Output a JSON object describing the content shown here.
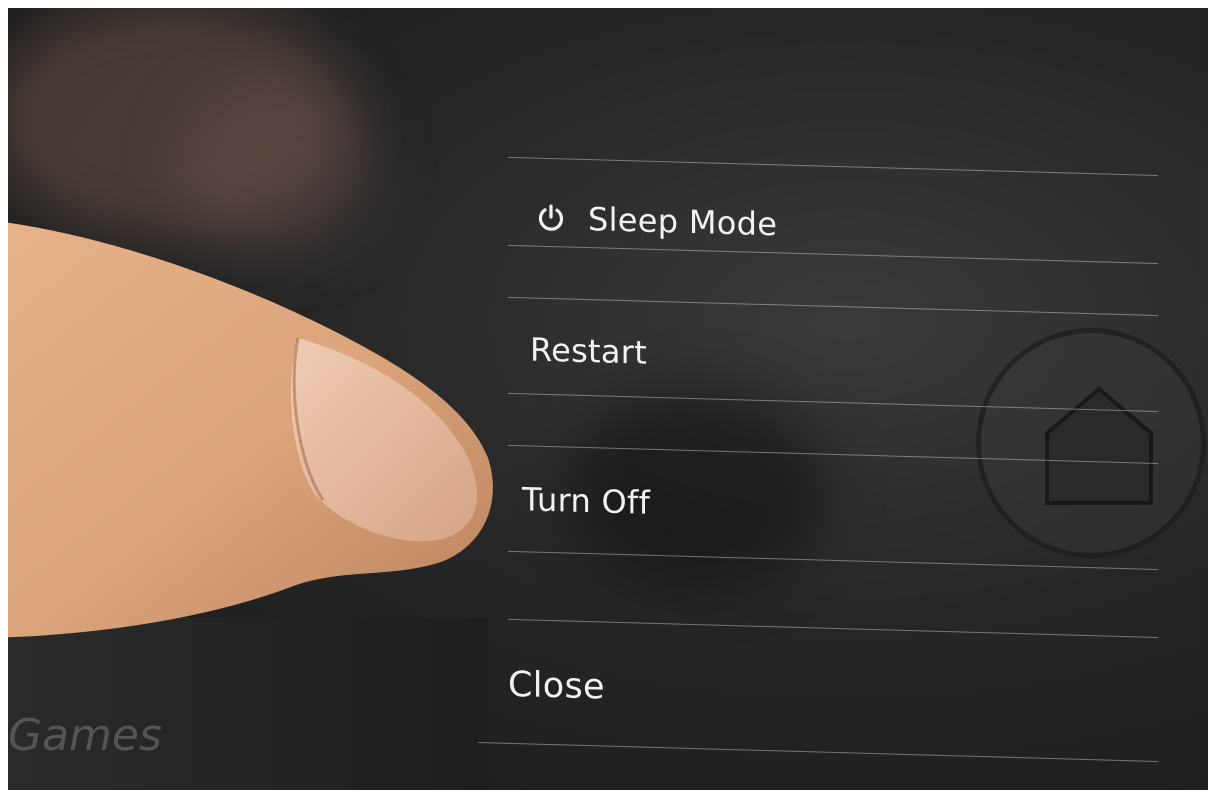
{
  "menu": {
    "items": [
      {
        "label": "Sleep Mode",
        "icon": "power-icon"
      },
      {
        "label": "Restart"
      },
      {
        "label": "Turn Off"
      },
      {
        "label": "Close"
      }
    ]
  },
  "background": {
    "games_label": "Games",
    "home_button_icon": "home-icon"
  },
  "colors": {
    "menu_text": "#f2f2f2",
    "divider": "#dcdcdc",
    "screen_bg": "#262626"
  }
}
